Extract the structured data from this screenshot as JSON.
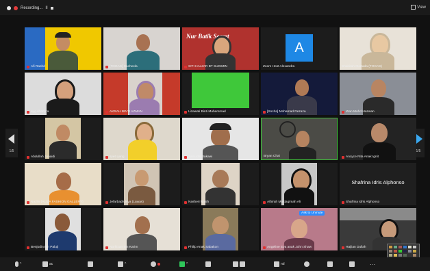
{
  "topbar": {
    "recording_label": "Recording...",
    "view_label": "View"
  },
  "nav": {
    "left_page": "1/5",
    "right_page": "1/5"
  },
  "tiles": [
    {
      "name": "Afi Rashd",
      "muted": true
    },
    {
      "name": "[TOGAS] Sacheela",
      "muted": true
    },
    {
      "name": "SITI HAJJAR BT SUKIMIN",
      "muted": true
    },
    {
      "name": "Zoom Host Alexandra",
      "muted": false
    },
    {
      "name": "Shakirah Mortada (TOGAS)",
      "muted": false
    },
    {
      "name": "ayg.sharfyra",
      "muted": true
    },
    {
      "name": "AKRAH BINTI AZMAN",
      "muted": true
    },
    {
      "name": "Lizawati Binti Muhammad",
      "muted": true
    },
    {
      "name": "[Socha] Mohamad Rezaza",
      "muted": true
    },
    {
      "name": "Wan Mohd Hazwan",
      "muted": true
    },
    {
      "name": "Abdullah Junaidi",
      "muted": true
    },
    {
      "name": "syeti yang",
      "muted": true
    },
    {
      "name": "Zainudin Bakawi",
      "muted": true
    },
    {
      "name": "Bryan Chai",
      "muted": true
    },
    {
      "name": "Ancyce Rita Anak Ignit",
      "muted": true
    },
    {
      "name": "Nazlin (ALIZA FASHION GALLERY)",
      "muted": true
    },
    {
      "name": "Jefarbadrulsya (Lawas)",
      "muted": true
    },
    {
      "name": "Nasheri Nasih",
      "muted": true
    },
    {
      "name": "Athirah Mustaqimah Ali",
      "muted": true
    },
    {
      "name": "Shafrina Idris Alphonso",
      "muted": true
    },
    {
      "name": "Benjodin Bin Paluji",
      "muted": true
    },
    {
      "name": "Norhizan Bin Karim",
      "muted": true
    },
    {
      "name": "Philip Anak Sabakon",
      "muted": true
    },
    {
      "name": "Angeline Eva anak John Shaw",
      "muted": true
    },
    {
      "name": "Haijian Dullah",
      "muted": true
    }
  ],
  "center_name": "Shafrina Idris Alphonso",
  "avatar_letter": "A",
  "banner_text": "Nur Batik Secret",
  "ask_label": "Ask to Unmute",
  "bottombar": {
    "tb2": "ac",
    "tb5": "nd"
  }
}
